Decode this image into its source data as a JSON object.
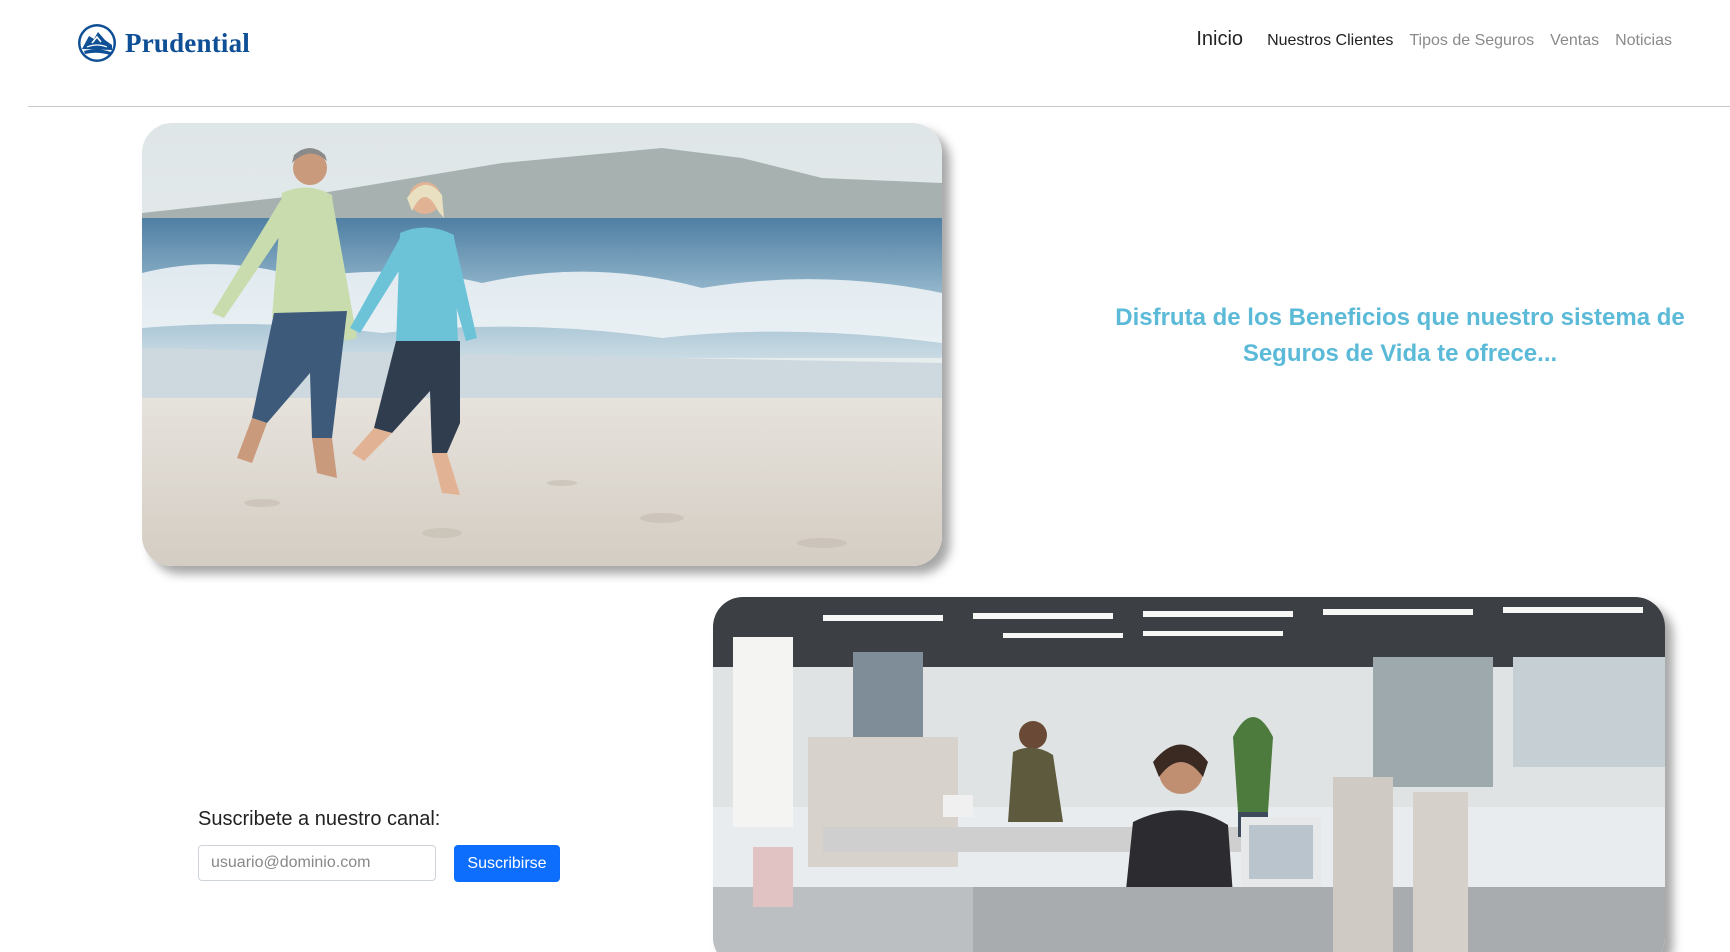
{
  "brand": {
    "name": "Prudential",
    "logo_icon": "rock-of-gibraltar-icon",
    "color": "#0f4f95"
  },
  "nav": {
    "items": [
      {
        "label": "Inicio",
        "state": "home"
      },
      {
        "label": "Nuestros Clientes",
        "state": "active"
      },
      {
        "label": "Tipos de Seguros",
        "state": "inactive"
      },
      {
        "label": "Ventas",
        "state": "inactive"
      },
      {
        "label": "Noticias",
        "state": "inactive"
      }
    ]
  },
  "hero": {
    "text": "Disfruta de los Beneficios que nuestro sistema de Seguros de Vida te ofrece...",
    "text_color": "#5bbad8"
  },
  "subscribe": {
    "label": "Suscribete a nuestro canal:",
    "placeholder": "usuario@dominio.com",
    "value": "",
    "button_label": "Suscribirse",
    "button_color": "#0d6efd"
  }
}
